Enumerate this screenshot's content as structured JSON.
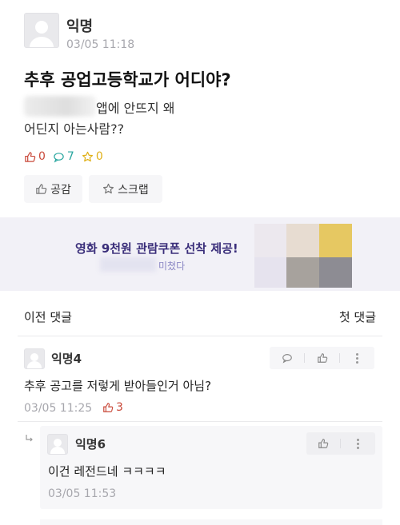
{
  "post": {
    "author": "익명",
    "timestamp": "03/05 11:18",
    "title": "추후 공업고등학교가 어디야?",
    "body_line1": "앱에 안뜨지 왜",
    "body_line2": "어딘지 아는사람??",
    "stats": {
      "likes": "0",
      "comments": "7",
      "scraps": "0"
    },
    "buttons": {
      "like": "공감",
      "scrap": "스크랩"
    }
  },
  "ad": {
    "headline": "영화 9천원 관람쿠폰 선착 제공!",
    "subline": "미쳤다"
  },
  "nav": {
    "prev": "이전 댓글",
    "first": "첫 댓글"
  },
  "comments": [
    {
      "author": "익명4",
      "text": "추후 공고를 저렇게 받아들인거 아님?",
      "timestamp": "03/05 11:25",
      "likes": "3"
    },
    {
      "author": "익명6",
      "text": "이건 레전드네 ㅋㅋㅋㅋ",
      "timestamp": "03/05 11:53"
    }
  ],
  "colors": {
    "like_red": "#c9493a",
    "comment_teal": "#2aa7a0",
    "scrap_yellow": "#e0b11a",
    "ad_purple": "#3a2e7a"
  }
}
